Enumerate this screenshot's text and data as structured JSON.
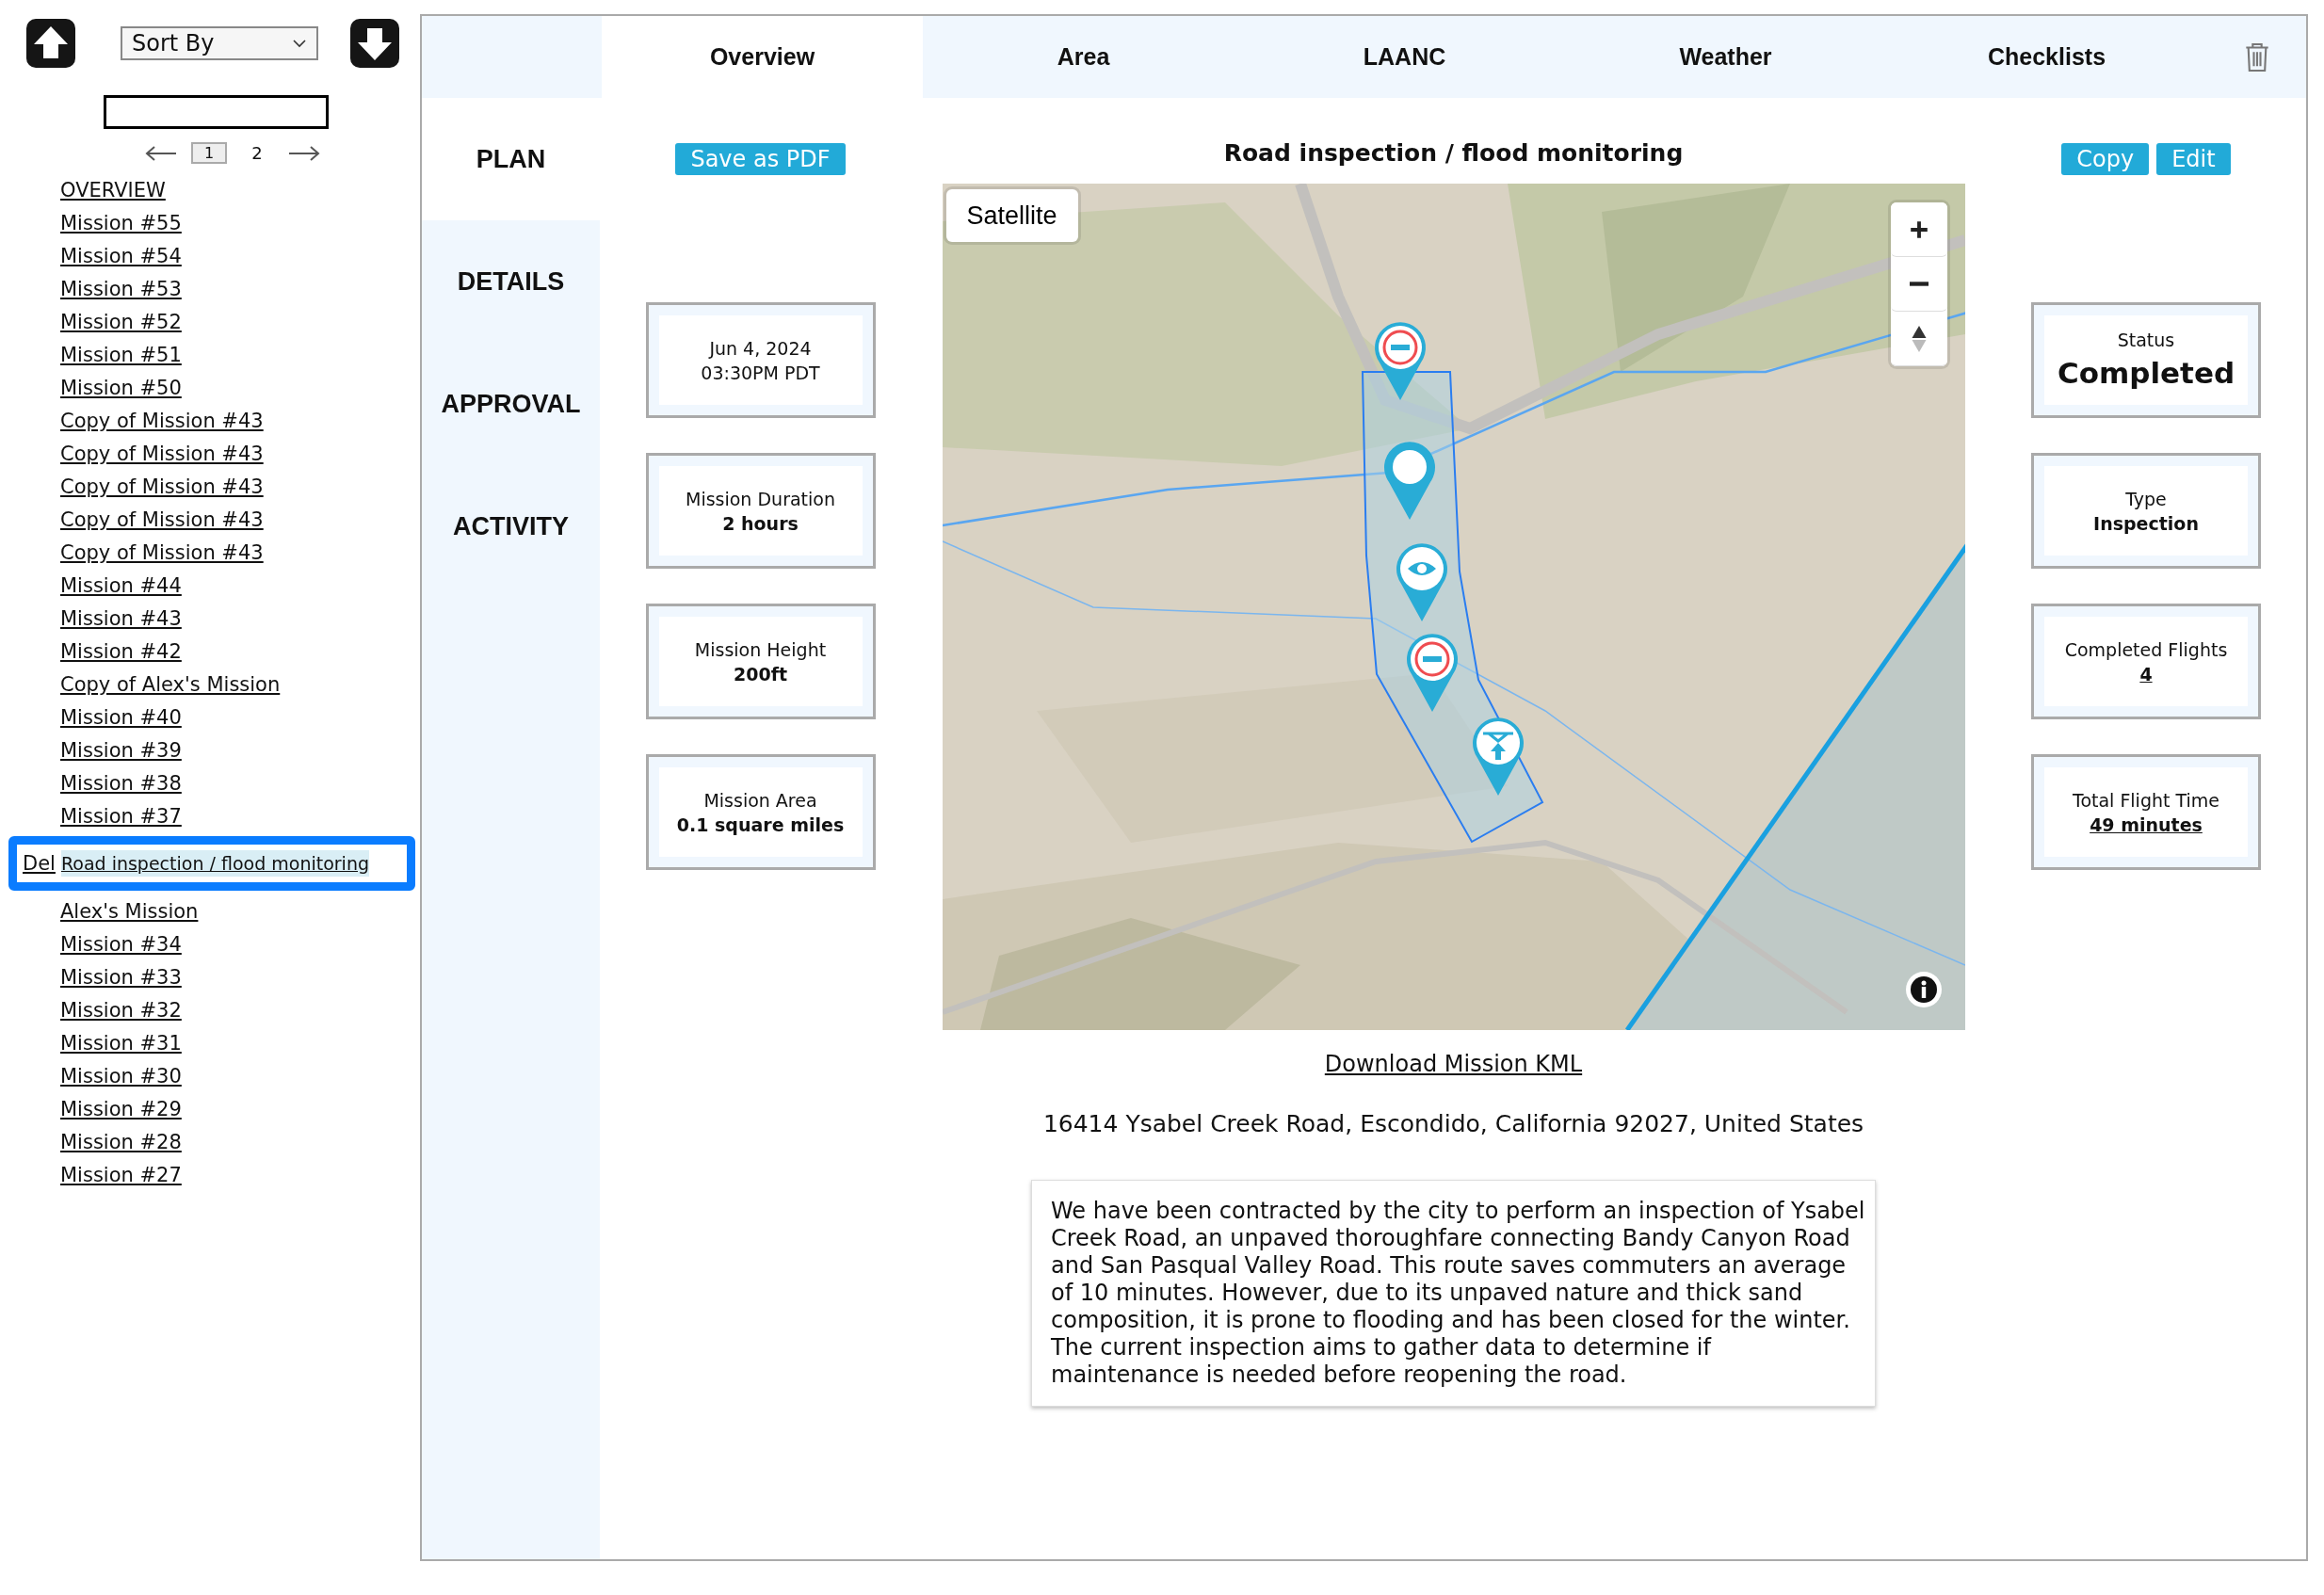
{
  "sidebar": {
    "sort": {
      "value": "Sort By"
    },
    "pages": [
      {
        "label": "1",
        "selected": true
      },
      {
        "label": "2",
        "selected": false
      }
    ],
    "items": [
      {
        "label": "OVERVIEW",
        "selected": false
      },
      {
        "label": "Mission #55",
        "selected": false
      },
      {
        "label": "Mission #54",
        "selected": false
      },
      {
        "label": "Mission #53",
        "selected": false
      },
      {
        "label": "Mission #52",
        "selected": false
      },
      {
        "label": "Mission #51",
        "selected": false
      },
      {
        "label": "Mission #50",
        "selected": false
      },
      {
        "label": "Copy of Mission #43",
        "selected": false
      },
      {
        "label": "Copy of Mission #43",
        "selected": false
      },
      {
        "label": "Copy of Mission #43",
        "selected": false
      },
      {
        "label": "Copy of Mission #43",
        "selected": false
      },
      {
        "label": "Copy of Mission #43",
        "selected": false
      },
      {
        "label": "Mission #44",
        "selected": false
      },
      {
        "label": "Mission #43",
        "selected": false
      },
      {
        "label": "Mission #42",
        "selected": false
      },
      {
        "label": "Copy of Alex's Mission",
        "selected": false
      },
      {
        "label": "Mission #40",
        "selected": false
      },
      {
        "label": "Mission #39",
        "selected": false
      },
      {
        "label": "Mission #38",
        "selected": false
      },
      {
        "label": "Mission #37",
        "selected": false
      },
      {
        "label": "Road inspection / flood monitoring",
        "selected": true,
        "action": "Del"
      },
      {
        "label": "Alex's Mission",
        "selected": false
      },
      {
        "label": "Mission #34",
        "selected": false
      },
      {
        "label": "Mission #33",
        "selected": false
      },
      {
        "label": "Mission #32",
        "selected": false
      },
      {
        "label": "Mission #31",
        "selected": false
      },
      {
        "label": "Mission #30",
        "selected": false
      },
      {
        "label": "Mission #29",
        "selected": false
      },
      {
        "label": "Mission #28",
        "selected": false
      },
      {
        "label": "Mission #27",
        "selected": false
      }
    ]
  },
  "tabs": [
    {
      "label": "Overview",
      "selected": true
    },
    {
      "label": "Area",
      "selected": false
    },
    {
      "label": "LAANC",
      "selected": false
    },
    {
      "label": "Weather",
      "selected": false
    },
    {
      "label": "Checklists",
      "selected": false
    }
  ],
  "nav": [
    {
      "label": "PLAN",
      "selected": true
    },
    {
      "label": "DETAILS",
      "selected": false
    },
    {
      "label": "APPROVAL",
      "selected": false
    },
    {
      "label": "ACTIVITY",
      "selected": false
    }
  ],
  "plan": {
    "save_button": "Save as PDF",
    "title": "Road inspection / flood monitoring",
    "actions": [
      "Copy",
      "Edit"
    ],
    "map": {
      "layer_button": "Satellite"
    },
    "left_cards": [
      {
        "kind": "datetime",
        "lines": [
          "Jun 4, 2024",
          "03:30PM PDT"
        ]
      },
      {
        "kind": "value",
        "label": "Mission Duration",
        "value": "2 hours"
      },
      {
        "kind": "value",
        "label": "Mission Height",
        "value": "200ft"
      },
      {
        "kind": "value",
        "label": "Mission Area",
        "value": "0.1 square miles"
      }
    ],
    "right_cards": [
      {
        "kind": "status",
        "label": "Status",
        "value": "Completed"
      },
      {
        "kind": "value",
        "label": "Type",
        "value": "Inspection"
      },
      {
        "kind": "link",
        "label": "Completed Flights",
        "value": "4"
      },
      {
        "kind": "link",
        "label": "Total Flight Time",
        "value": "49 minutes"
      }
    ],
    "download_link": "Download Mission KML",
    "address": "16414 Ysabel Creek Road, Escondido, California 92027, United States",
    "description": "We have been contracted by the city to perform an inspection of Ysabel Creek Road, an unpaved thoroughfare connecting Bandy Canyon Road and San Pasqual Valley Road. This route saves commuters an average of 10 minutes. However, due to its unpaved nature and thick sand composition, it is prone to flooding and has been closed for the winter. The current inspection aims to gather data to determine if maintenance is needed before reopening the road."
  }
}
